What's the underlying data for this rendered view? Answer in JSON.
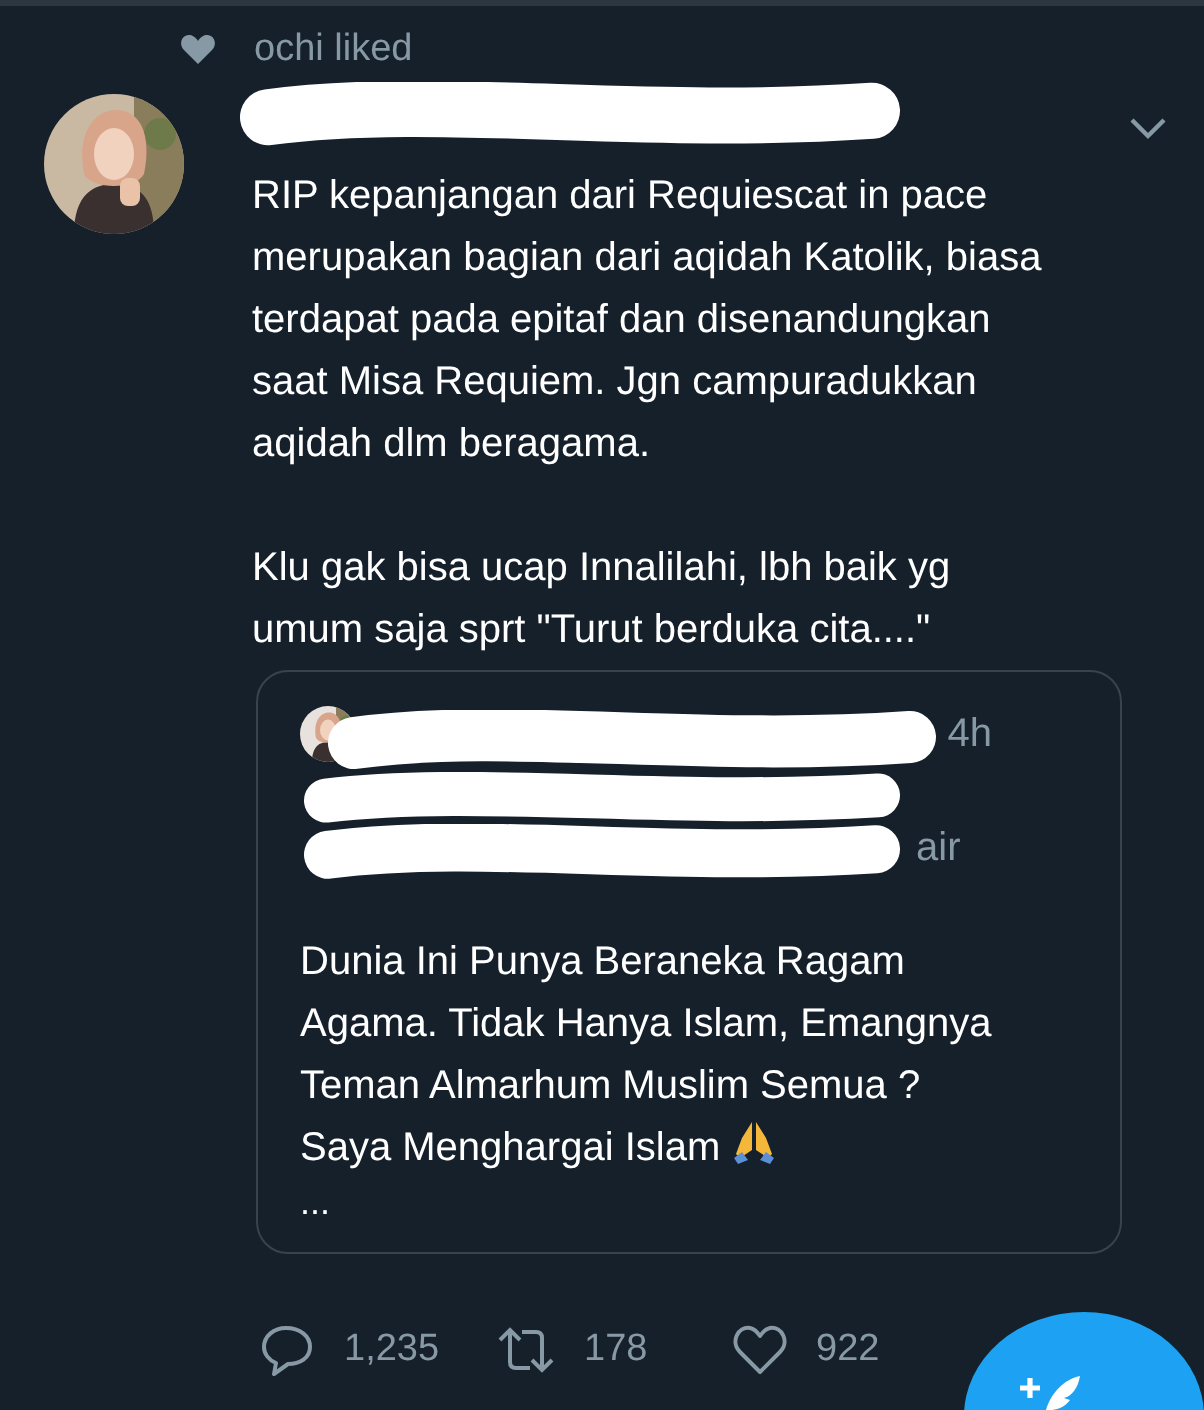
{
  "social_context": {
    "text": "ochi liked"
  },
  "tweet": {
    "paragraphs": [
      "RIP kepanjangan dari Requiescat in pace\nmerupakan bagian dari aqidah Katolik, biasa\nterdapat pada epitaf dan disenandungkan\nsaat Misa Requiem. Jgn campuradukkan\naqidah dlm beragama.",
      "Klu gak bisa ucap Innalilahi, lbh baik yg\numum saja sprt \"Turut berduka cita....\""
    ]
  },
  "quote": {
    "time": "4h",
    "handle_fragment": "air",
    "text": "Dunia Ini Punya Beraneka Ragam\nAgama. Tidak Hanya Islam, Emangnya\nTeman Almarhum Muslim Semua ?\nSaya Menghargai Islam",
    "more": "..."
  },
  "actions": [
    {
      "kind": "reply",
      "count": "1,235"
    },
    {
      "kind": "retweet",
      "count": "178"
    },
    {
      "kind": "like",
      "count": "922"
    }
  ]
}
